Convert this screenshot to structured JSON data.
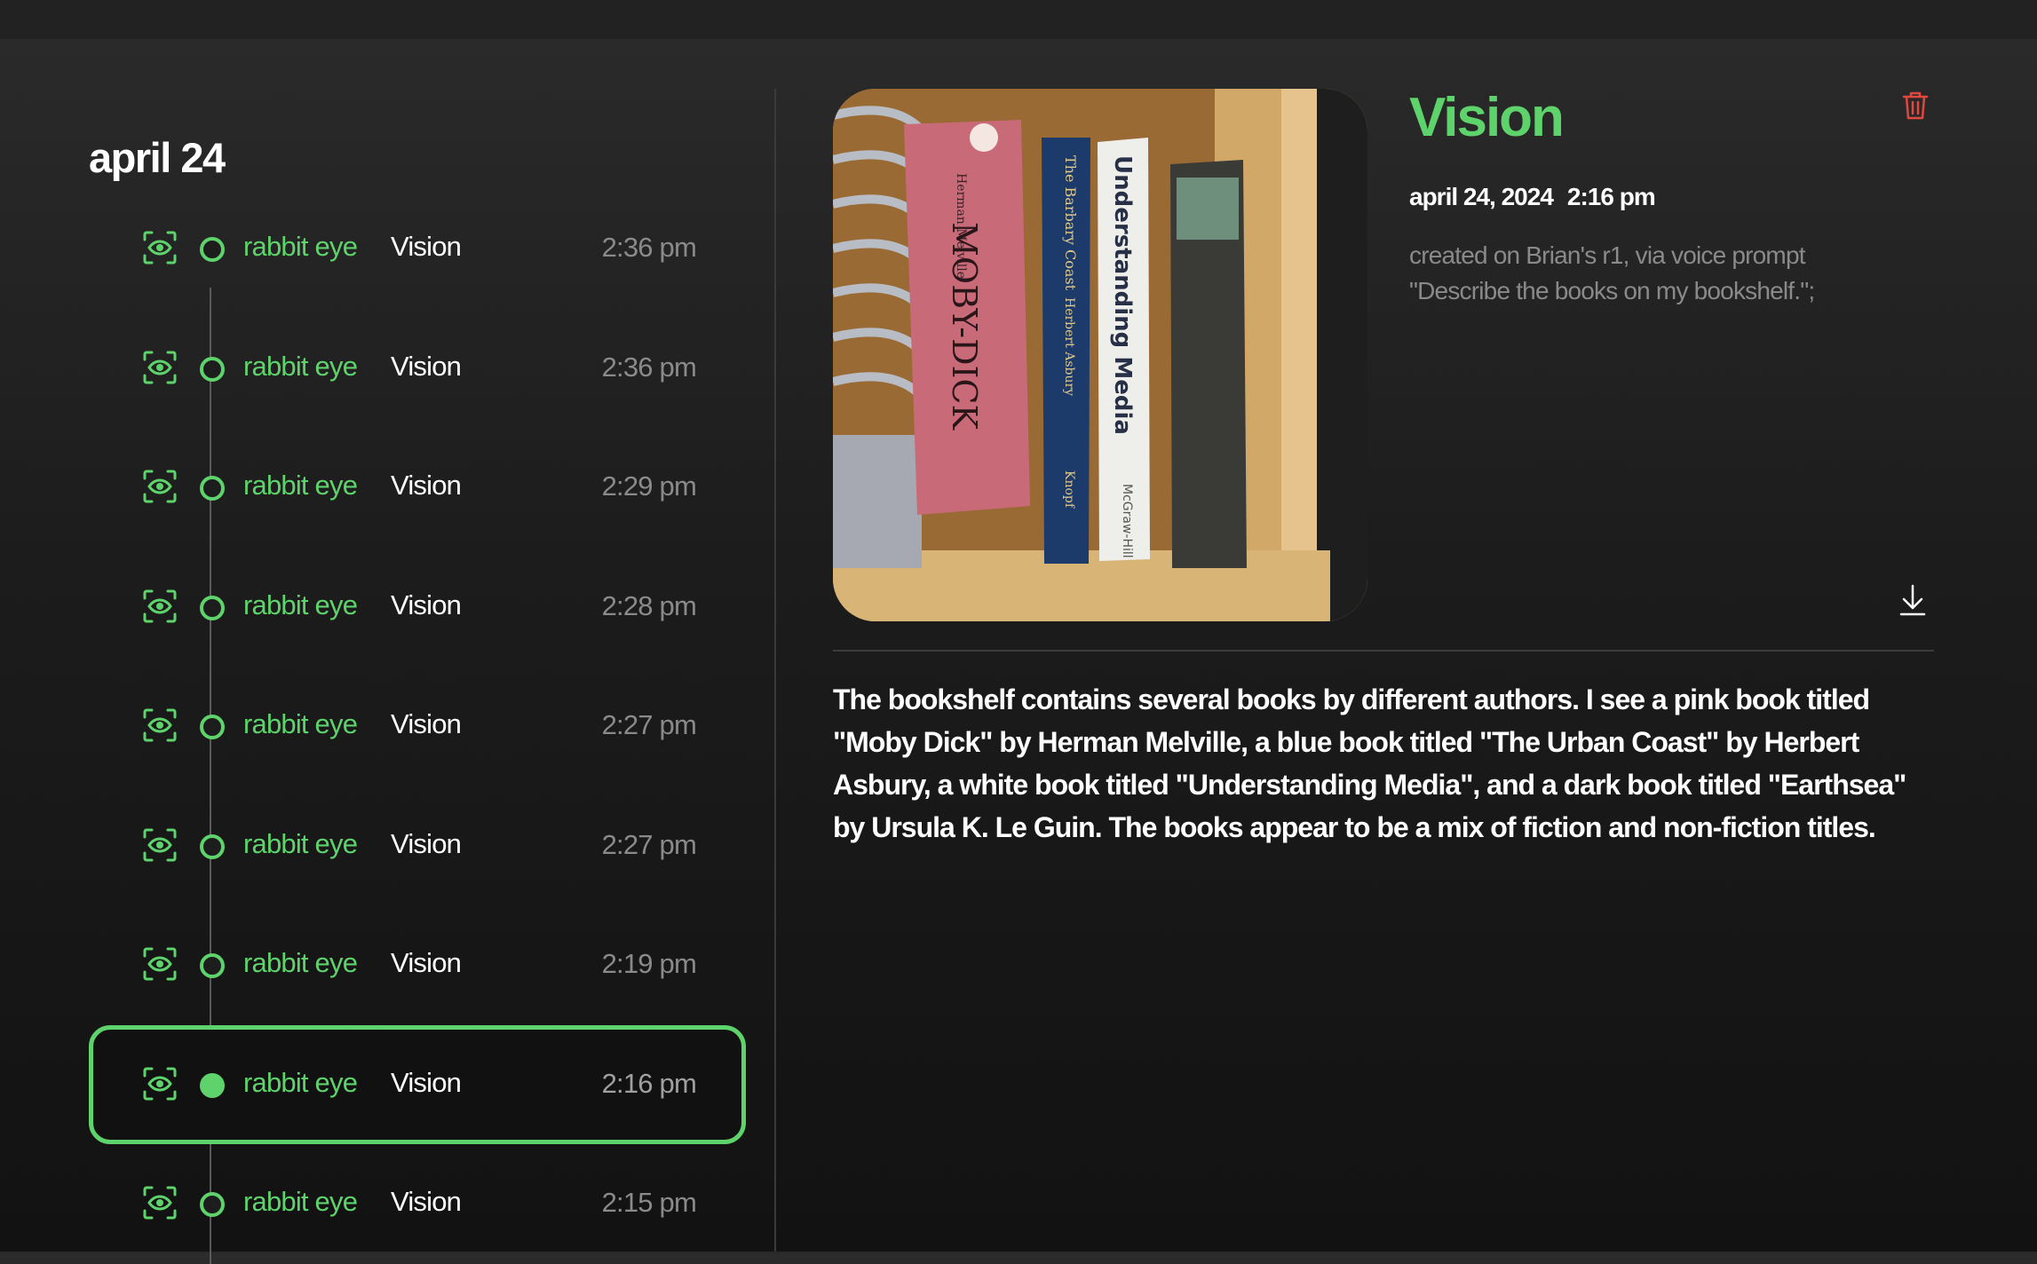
{
  "colors": {
    "accent": "#5ed36b",
    "delete": "#e0483e",
    "muted": "#8a8a8a"
  },
  "sidebar": {
    "date_heading": "april 24",
    "entries": [
      {
        "source": "rabbit eye",
        "type": "Vision",
        "time": "2:36 pm",
        "icon": "eye-scan-icon",
        "selected": false
      },
      {
        "source": "rabbit eye",
        "type": "Vision",
        "time": "2:36 pm",
        "icon": "eye-scan-icon",
        "selected": false
      },
      {
        "source": "rabbit eye",
        "type": "Vision",
        "time": "2:29 pm",
        "icon": "eye-scan-icon",
        "selected": false
      },
      {
        "source": "rabbit eye",
        "type": "Vision",
        "time": "2:28 pm",
        "icon": "eye-scan-icon",
        "selected": false
      },
      {
        "source": "rabbit eye",
        "type": "Vision",
        "time": "2:27 pm",
        "icon": "eye-scan-icon",
        "selected": false
      },
      {
        "source": "rabbit eye",
        "type": "Vision",
        "time": "2:27 pm",
        "icon": "eye-scan-icon",
        "selected": false
      },
      {
        "source": "rabbit eye",
        "type": "Vision",
        "time": "2:19 pm",
        "icon": "eye-scan-icon",
        "selected": false
      },
      {
        "source": "rabbit eye",
        "type": "Vision",
        "time": "2:16 pm",
        "icon": "eye-scan-icon",
        "selected": true
      },
      {
        "source": "rabbit eye",
        "type": "Vision",
        "time": "2:15 pm",
        "icon": "eye-scan-icon",
        "selected": false
      }
    ]
  },
  "detail": {
    "title": "Vision",
    "date": "april 24, 2024",
    "time": "2:16 pm",
    "meta_line1": "created on Brian's r1, via voice prompt",
    "meta_line2": "\"Describe the books on my bookshelf.\";",
    "delete_icon": "trash-icon",
    "download_icon": "download-icon",
    "photo": {
      "book_1_title": "MOBY-DICK",
      "book_1_author": "Herman Melville",
      "book_2_title": "The Barbary Coast",
      "book_2_author": "Herbert Asbury",
      "book_2_publisher": "Knopf",
      "book_3_title": "Understanding Media",
      "book_3_publisher": "McGraw-Hill"
    },
    "description": "The bookshelf contains several books by different authors. I see a pink book titled \"Moby Dick\" by Herman Melville, a blue book titled \"The Urban Coast\" by Herbert Asbury, a white book titled \"Understanding Media\", and a dark book titled \"Earthsea\" by Ursula K. Le Guin. The books appear to be a mix of fiction and non-fiction titles."
  }
}
